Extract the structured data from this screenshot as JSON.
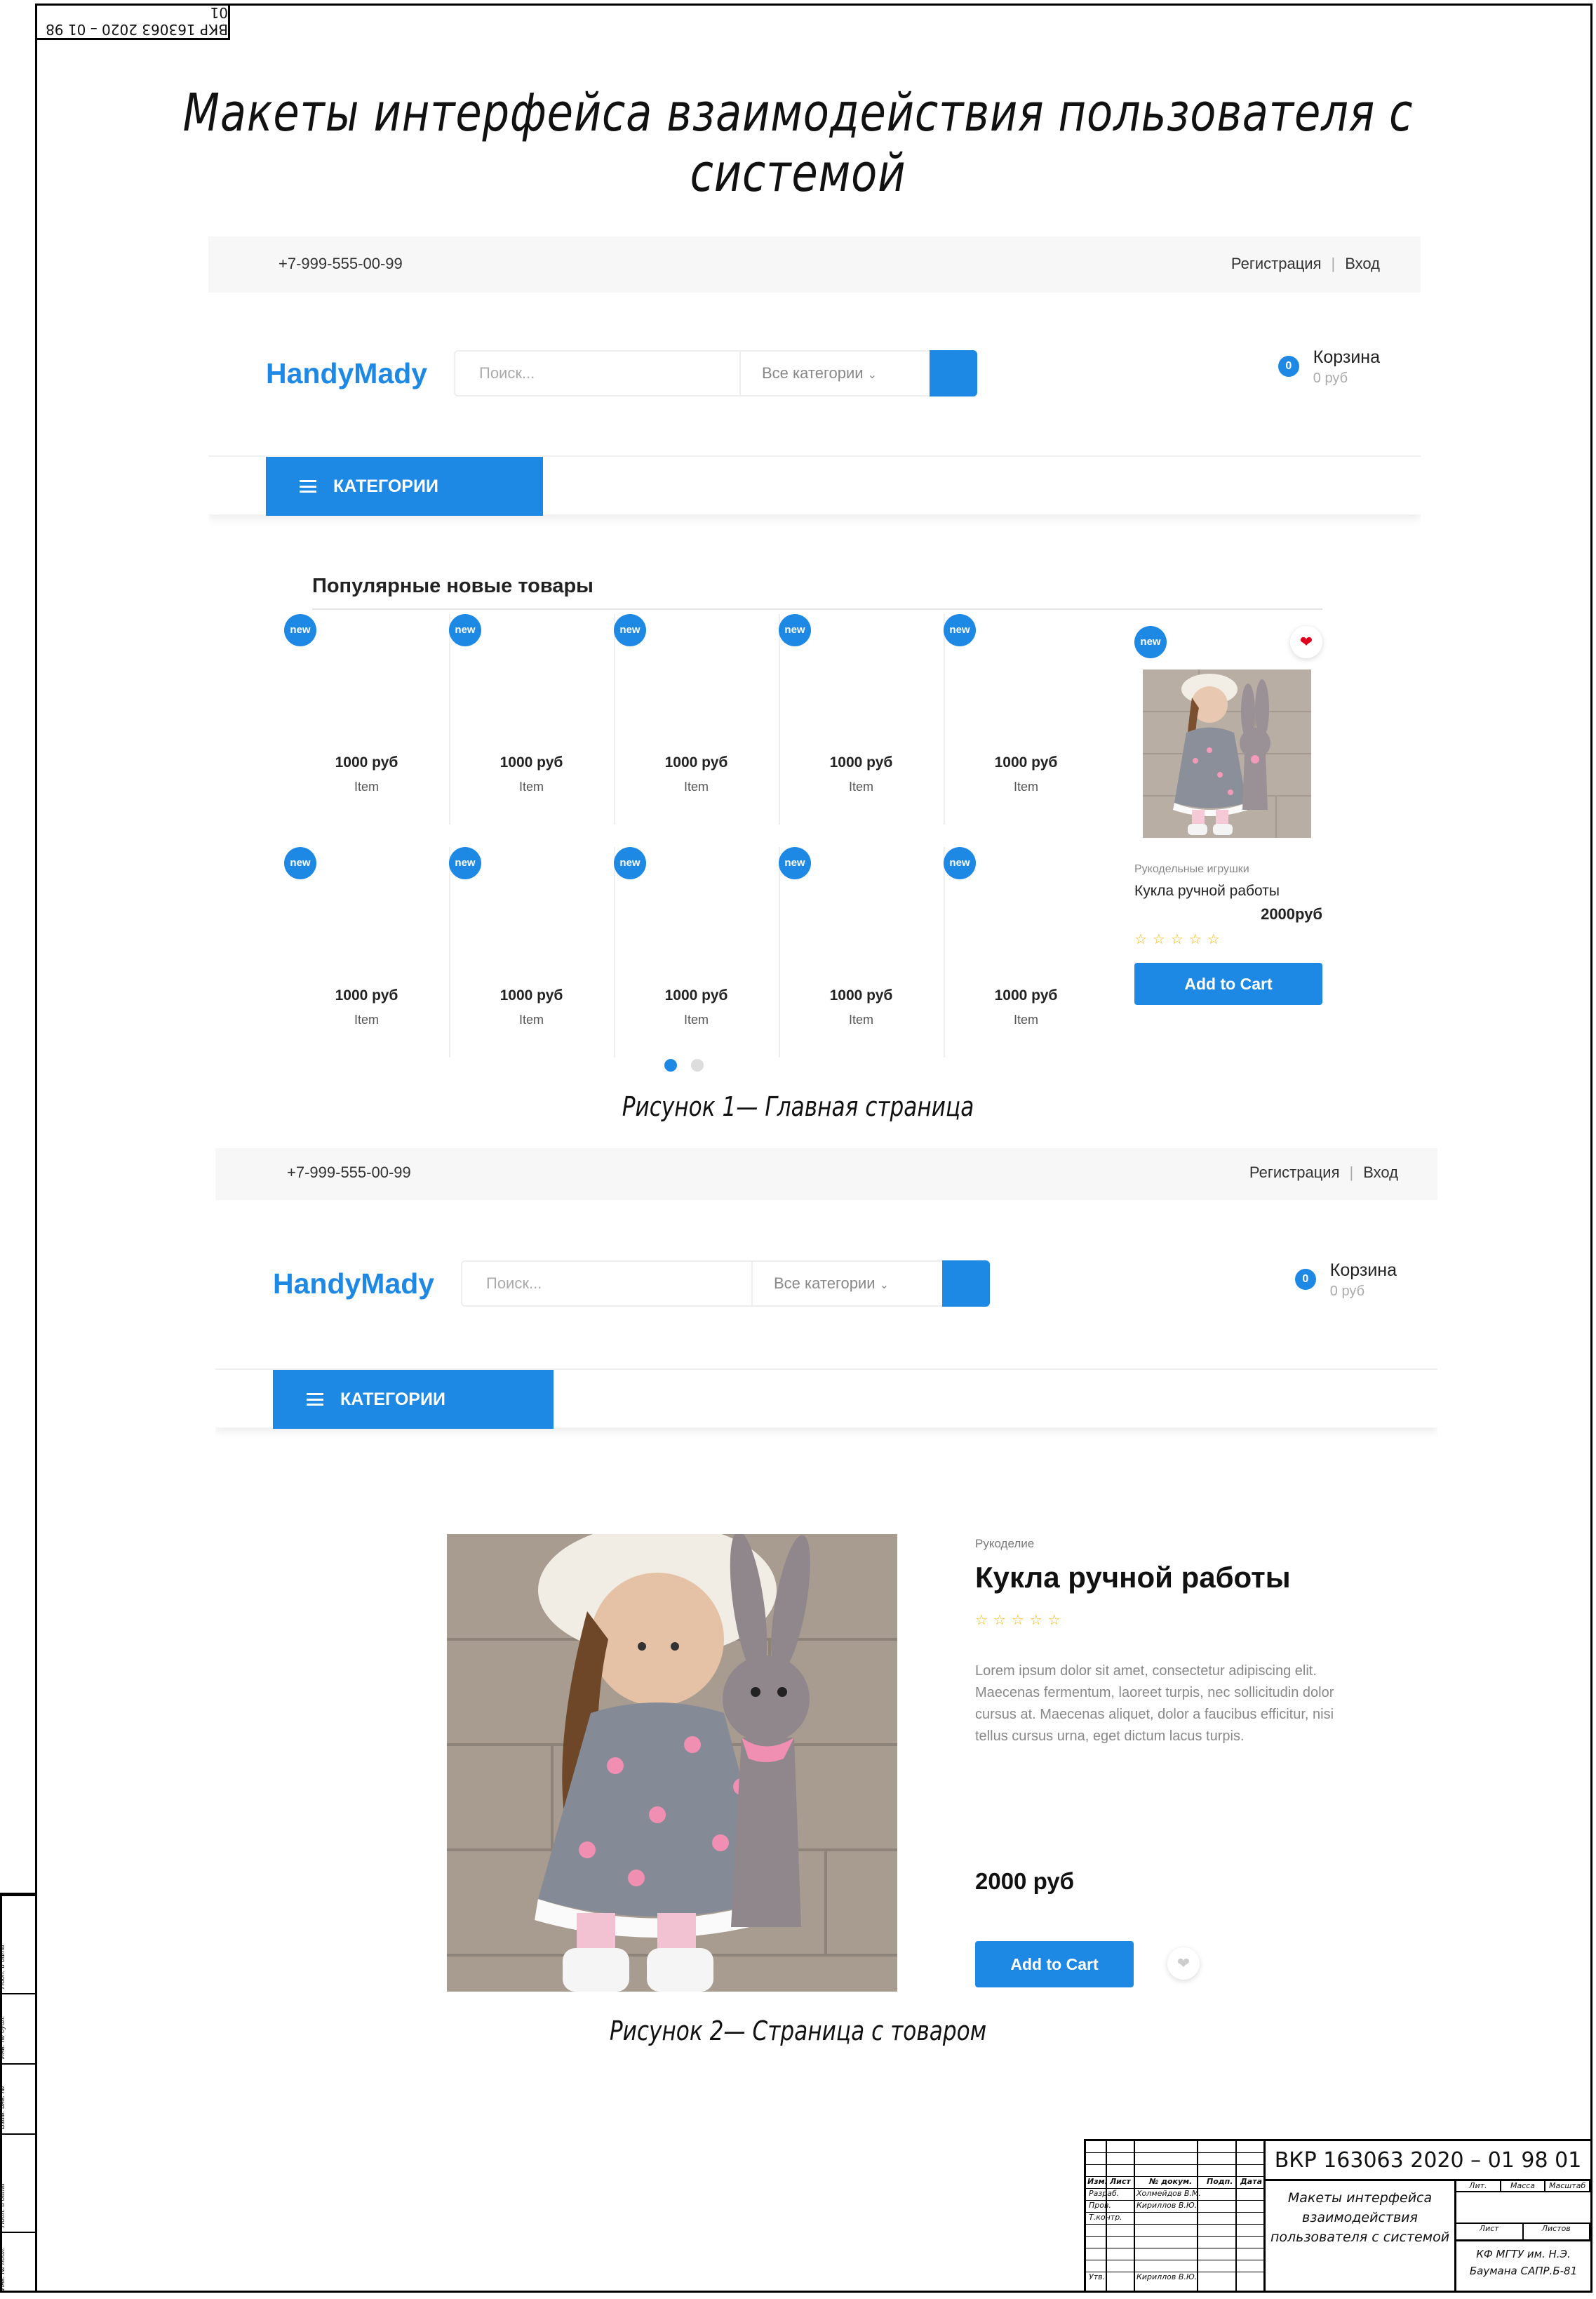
{
  "sheet": {
    "stamp": "ВКР 163063 2020 – 01 98 01",
    "title": "Макеты интерфейса взаимодействия пользователя с системой",
    "caption1": "Рисунок 1— Главная страница",
    "caption2": "Рисунок 2— Страница с товаром"
  },
  "store": {
    "phone": "+7-999-555-00-99",
    "register": "Регистрация",
    "login": "Вход",
    "logo": "HandyMady",
    "search_placeholder": "Поиск...",
    "all_categories": "Все категории",
    "cart_count": "0",
    "cart_label": "Корзина",
    "cart_sum": "0 руб",
    "categories_button": "КАТЕГОРИИ",
    "brand_color": "#1e88e5"
  },
  "home": {
    "section_title": "Популярные новые товары",
    "badge": "new",
    "items": [
      {
        "price": "1000 руб",
        "name": "Item"
      },
      {
        "price": "1000 руб",
        "name": "Item"
      },
      {
        "price": "1000 руб",
        "name": "Item"
      },
      {
        "price": "1000 руб",
        "name": "Item"
      },
      {
        "price": "1000 руб",
        "name": "Item"
      },
      {
        "price": "1000 руб",
        "name": "Item"
      },
      {
        "price": "1000 руб",
        "name": "Item"
      },
      {
        "price": "1000 руб",
        "name": "Item"
      },
      {
        "price": "1000 руб",
        "name": "Item"
      },
      {
        "price": "1000 руб",
        "name": "Item"
      }
    ],
    "featured": {
      "category": "Рукодельные игрушки",
      "name": "Кукла ручной работы",
      "price": "2000руб",
      "stars": "☆☆☆☆☆",
      "add_to_cart": "Add to Cart"
    },
    "carousel_dots": [
      "active",
      "inactive"
    ]
  },
  "product": {
    "category": "Рукоделие",
    "name": "Кукла ручной работы",
    "stars": "☆☆☆☆☆",
    "description": "Lorem ipsum dolor sit amet, consectetur adipiscing elit. Maecenas fermentum, laoreet turpis, nec sollicitudin dolor cursus at. Maecenas aliquet, dolor a faucibus efficitur, nisi tellus cursus urna, eget dictum lacus turpis.",
    "price": "2000 руб",
    "add_to_cart": "Add to Cart"
  },
  "title_block": {
    "doc_code": "ВКР 163063 2020 – 01 98 01",
    "doc_name": "Макеты интерфейса взаимодействия пользователя с системой",
    "col_headers": [
      "Изм.",
      "Лист",
      "№ докум.",
      "Подп.",
      "Дата"
    ],
    "rows": [
      {
        "role": "Разраб.",
        "person": "Холмейдов В.М."
      },
      {
        "role": "Пров.",
        "person": "Кириллов В.Ю."
      },
      {
        "role": "Т.контр.",
        "person": ""
      },
      {
        "role": "Утв.",
        "person": "Кириллов В.Ю."
      }
    ],
    "grid_top": [
      "Лит.",
      "Масса",
      "Масштаб"
    ],
    "grid_bottom": [
      "Лист",
      "Листов"
    ],
    "organization": "КФ МГТУ им. Н.Э. Баумана САПР.Б-81"
  },
  "side_strip": [
    "Подп. и дата",
    "Инв. № дубл.",
    "Взам. инв. №",
    "Подп. и дата",
    "Инв. № подл."
  ]
}
